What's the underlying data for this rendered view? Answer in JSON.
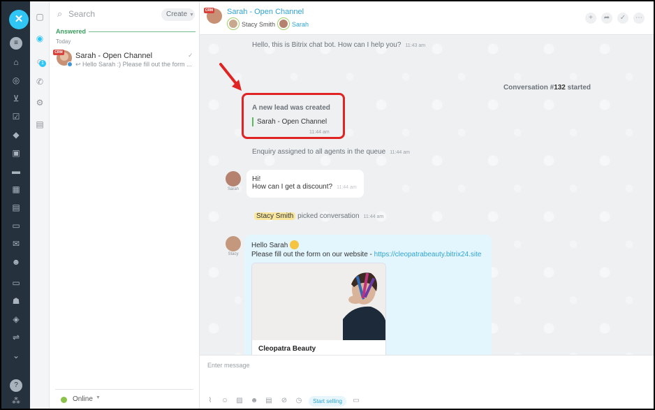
{
  "list": {
    "search_placeholder": "Search",
    "create_label": "Create",
    "section_label": "Answered",
    "day_label": "Today",
    "chat": {
      "badge": "CRM",
      "name": "Sarah - Open Channel",
      "preview": "Hello Sarah :) Please fill out the form ..."
    },
    "status_label": "Online"
  },
  "header": {
    "badge": "CRM",
    "title": "Sarah - Open Channel",
    "participants": [
      "Stacy Smith",
      "Sarah"
    ]
  },
  "messages": {
    "bot_text": "Hello, this is Bitrix chat bot. How can I help you?",
    "bot_time": "11:43 am",
    "conversation_prefix": "Conversation #",
    "conversation_number": "132",
    "conversation_suffix": " started",
    "lead_title": "A new lead was created",
    "lead_name": "Sarah - Open Channel",
    "lead_time": "11:44 am",
    "enquiry_text": "Enquiry assigned to all agents in the queue",
    "enquiry_time": "11:44 am",
    "sarah_avatar_name": "Sarah",
    "sarah_line1": "Hi!",
    "sarah_line2": "How can I get a discount?",
    "sarah_time": "11:44 am",
    "agent_tag": "Stacy Smith",
    "picked_text": "picked conversation",
    "picked_time": "11:44 am",
    "stacy_avatar_name": "Stacy",
    "stacy_line1": "Hello Sarah",
    "stacy_line2_prefix": "Please fill out the form on our website - ",
    "stacy_link": "https://cleopatrabeauty.bitrix24.site",
    "card_title": "Cleopatra Beauty"
  },
  "composer": {
    "placeholder": "Enter message",
    "sell_button": "Start selling"
  },
  "colors": {
    "accent": "#2fc6f6",
    "highlight_border": "#e02424",
    "online": "#8bc34a",
    "section": "#3a9e5e"
  }
}
